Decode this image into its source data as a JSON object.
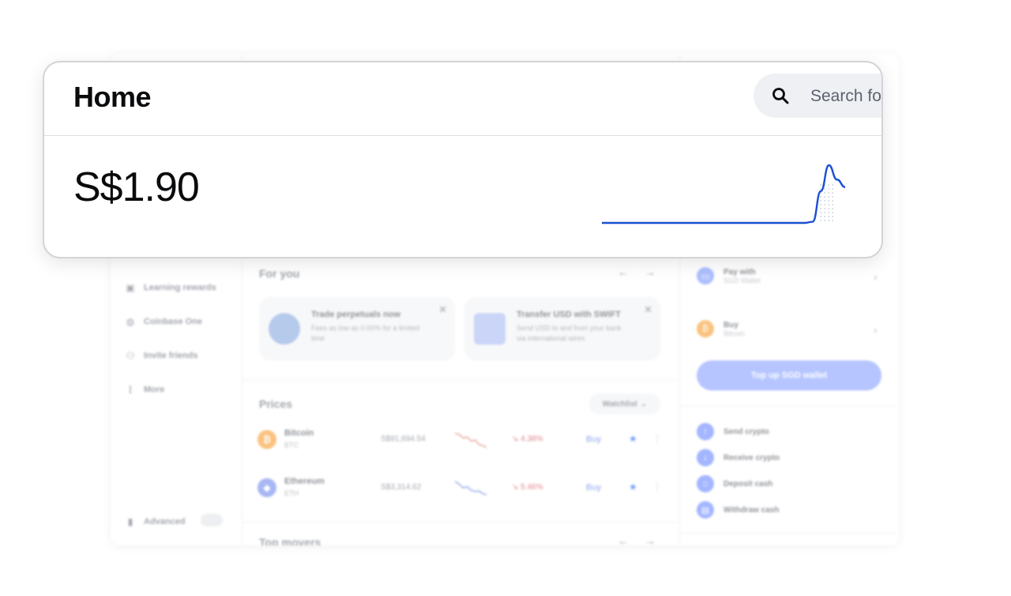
{
  "header": {
    "title": "Home",
    "search": {
      "placeholder": "Search for an asset"
    }
  },
  "portfolio": {
    "balance": "S$1.90",
    "chart_data": {
      "type": "line",
      "title": "",
      "series": [
        {
          "values": [
            0,
            0,
            0,
            0,
            0,
            0,
            0,
            0,
            0,
            0,
            0,
            0,
            0,
            0,
            0,
            0,
            0,
            0,
            0,
            0,
            0,
            0,
            0,
            0,
            0,
            0,
            0.02,
            0.55,
            1.0,
            0.75,
            0.62
          ]
        }
      ],
      "color": "#1a4fd0"
    }
  },
  "sidebar": {
    "items": [
      {
        "label": "Learning rewards",
        "icon": "gift-icon"
      },
      {
        "label": "Coinbase One",
        "icon": "globe-icon"
      },
      {
        "label": "Invite friends",
        "icon": "person-add-icon"
      },
      {
        "label": "More",
        "icon": "more-vertical-icon"
      }
    ],
    "advanced_label": "Advanced"
  },
  "for_you": {
    "title": "For you",
    "cards": [
      {
        "title": "Trade perpetuals now",
        "body": "Fees as low as 0.00% for a limited time"
      },
      {
        "title": "Transfer USD with SWIFT",
        "body": "Send USD to and from your bank via international wires"
      }
    ]
  },
  "prices": {
    "title": "Prices",
    "filter_label": "Watchlist",
    "rows": [
      {
        "name": "Bitcoin",
        "symbol": "BTC",
        "price": "S$91,694.54",
        "change": "↘ 4.38%",
        "buy": "Buy",
        "color": "#f7931a"
      },
      {
        "name": "Ethereum",
        "symbol": "ETH",
        "price": "S$3,314.62",
        "change": "↘ 5.46%",
        "buy": "Buy",
        "color": "#627eea"
      }
    ]
  },
  "top_movers": {
    "title": "Top movers"
  },
  "wallet": {
    "pay_with": {
      "label": "Pay with",
      "value": "SGD Wallet"
    },
    "buy": {
      "label": "Buy",
      "value": "Bitcoin"
    },
    "topup_label": "Top up SGD wallet",
    "actions": [
      "Send crypto",
      "Receive crypto",
      "Deposit cash",
      "Withdraw cash"
    ]
  }
}
